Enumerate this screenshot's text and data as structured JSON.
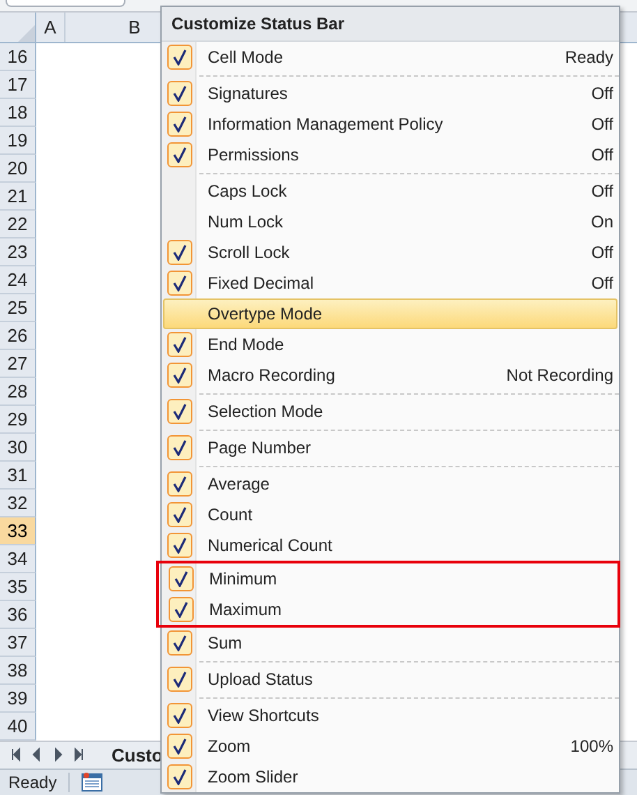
{
  "sheet": {
    "columns": [
      {
        "label": "A"
      },
      {
        "label": "B"
      }
    ],
    "rows": [
      {
        "label": "16",
        "selected": false
      },
      {
        "label": "17",
        "selected": false
      },
      {
        "label": "18",
        "selected": false
      },
      {
        "label": "19",
        "selected": false
      },
      {
        "label": "20",
        "selected": false
      },
      {
        "label": "21",
        "selected": false
      },
      {
        "label": "22",
        "selected": false
      },
      {
        "label": "23",
        "selected": false
      },
      {
        "label": "24",
        "selected": false
      },
      {
        "label": "25",
        "selected": false
      },
      {
        "label": "26",
        "selected": false
      },
      {
        "label": "27",
        "selected": false
      },
      {
        "label": "28",
        "selected": false
      },
      {
        "label": "29",
        "selected": false
      },
      {
        "label": "30",
        "selected": false
      },
      {
        "label": "31",
        "selected": false
      },
      {
        "label": "32",
        "selected": false
      },
      {
        "label": "33",
        "selected": true
      },
      {
        "label": "34",
        "selected": false
      },
      {
        "label": "35",
        "selected": false
      },
      {
        "label": "36",
        "selected": false
      },
      {
        "label": "37",
        "selected": false
      },
      {
        "label": "38",
        "selected": false
      },
      {
        "label": "39",
        "selected": false
      },
      {
        "label": "40",
        "selected": false
      }
    ],
    "sheet_tab": "Custo",
    "status": "Ready"
  },
  "menu": {
    "title": "Customize Status Bar",
    "items": [
      {
        "kind": "option",
        "label": "Cell Mode",
        "value": "Ready",
        "checked": true,
        "hovered": false,
        "annotated": false
      },
      {
        "kind": "separator"
      },
      {
        "kind": "option",
        "label": "Signatures",
        "value": "Off",
        "checked": true,
        "hovered": false,
        "annotated": false
      },
      {
        "kind": "option",
        "label": "Information Management Policy",
        "value": "Off",
        "checked": true,
        "hovered": false,
        "annotated": false
      },
      {
        "kind": "option",
        "label": "Permissions",
        "value": "Off",
        "checked": true,
        "hovered": false,
        "annotated": false
      },
      {
        "kind": "separator"
      },
      {
        "kind": "option",
        "label": "Caps Lock",
        "value": "Off",
        "checked": false,
        "hovered": false,
        "annotated": false
      },
      {
        "kind": "option",
        "label": "Num Lock",
        "value": "On",
        "checked": false,
        "hovered": false,
        "annotated": false
      },
      {
        "kind": "option",
        "label": "Scroll Lock",
        "value": "Off",
        "checked": true,
        "hovered": false,
        "annotated": false
      },
      {
        "kind": "option",
        "label": "Fixed Decimal",
        "value": "Off",
        "checked": true,
        "hovered": false,
        "annotated": false
      },
      {
        "kind": "option",
        "label": "Overtype Mode",
        "checked": false,
        "hovered": true,
        "annotated": false
      },
      {
        "kind": "option",
        "label": "End Mode",
        "checked": true,
        "hovered": false,
        "annotated": false
      },
      {
        "kind": "option",
        "label": "Macro Recording",
        "value": "Not Recording",
        "checked": true,
        "hovered": false,
        "annotated": false
      },
      {
        "kind": "separator"
      },
      {
        "kind": "option",
        "label": "Selection Mode",
        "checked": true,
        "hovered": false,
        "annotated": false
      },
      {
        "kind": "separator"
      },
      {
        "kind": "option",
        "label": "Page Number",
        "checked": true,
        "hovered": false,
        "annotated": false
      },
      {
        "kind": "separator"
      },
      {
        "kind": "option",
        "label": "Average",
        "checked": true,
        "hovered": false,
        "annotated": false
      },
      {
        "kind": "option",
        "label": "Count",
        "checked": true,
        "hovered": false,
        "annotated": false
      },
      {
        "kind": "option",
        "label": "Numerical Count",
        "checked": true,
        "hovered": false,
        "annotated": false
      },
      {
        "kind": "option",
        "label": "Minimum",
        "checked": true,
        "hovered": false,
        "annotated": true
      },
      {
        "kind": "option",
        "label": "Maximum",
        "checked": true,
        "hovered": false,
        "annotated": true
      },
      {
        "kind": "option",
        "label": "Sum",
        "checked": true,
        "hovered": false,
        "annotated": false
      },
      {
        "kind": "separator"
      },
      {
        "kind": "option",
        "label": "Upload Status",
        "checked": true,
        "hovered": false,
        "annotated": false
      },
      {
        "kind": "separator"
      },
      {
        "kind": "option",
        "label": "View Shortcuts",
        "checked": true,
        "hovered": false,
        "annotated": false
      },
      {
        "kind": "option",
        "label": "Zoom",
        "value": "100%",
        "checked": true,
        "hovered": false,
        "annotated": false
      },
      {
        "kind": "option",
        "label": "Zoom Slider",
        "checked": true,
        "hovered": false,
        "annotated": false
      }
    ]
  }
}
